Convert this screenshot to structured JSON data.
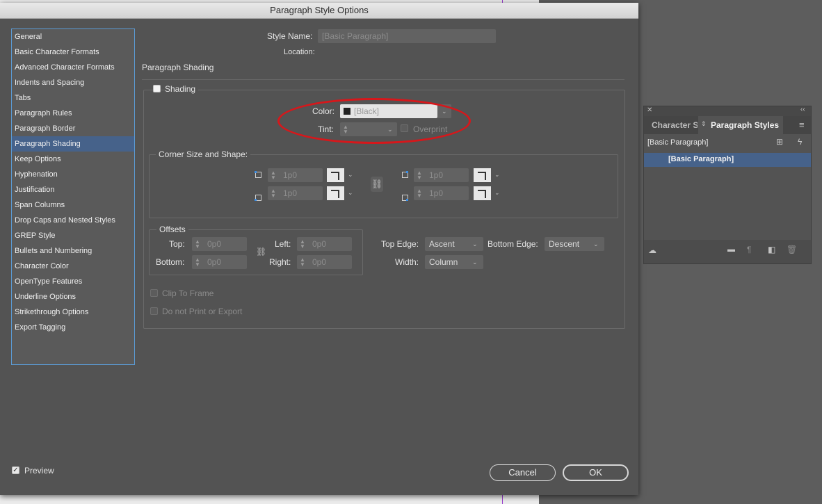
{
  "dialog": {
    "title": "Paragraph Style Options",
    "style_name_label": "Style Name:",
    "style_name_value": "[Basic Paragraph]",
    "location_label": "Location:",
    "section_title": "Paragraph Shading",
    "sidebar": [
      {
        "label": "General"
      },
      {
        "label": "Basic Character Formats"
      },
      {
        "label": "Advanced Character Formats"
      },
      {
        "label": "Indents and Spacing"
      },
      {
        "label": "Tabs"
      },
      {
        "label": "Paragraph Rules"
      },
      {
        "label": "Paragraph Border"
      },
      {
        "label": "Paragraph Shading",
        "selected": true
      },
      {
        "label": "Keep Options"
      },
      {
        "label": "Hyphenation"
      },
      {
        "label": "Justification"
      },
      {
        "label": "Span Columns"
      },
      {
        "label": "Drop Caps and Nested Styles"
      },
      {
        "label": "GREP Style"
      },
      {
        "label": "Bullets and Numbering"
      },
      {
        "label": "Character Color"
      },
      {
        "label": "OpenType Features"
      },
      {
        "label": "Underline Options"
      },
      {
        "label": "Strikethrough Options"
      },
      {
        "label": "Export Tagging"
      }
    ],
    "shading": {
      "checkbox_label": "Shading",
      "checked": false,
      "color_label": "Color:",
      "color_value": "[Black]",
      "tint_label": "Tint:",
      "tint_value": "",
      "overprint_label": "Overprint"
    },
    "corner": {
      "title": "Corner Size and Shape:",
      "values": [
        "1p0",
        "1p0",
        "1p0",
        "1p0"
      ]
    },
    "offsets": {
      "title": "Offsets",
      "top_label": "Top:",
      "top_value": "0p0",
      "bottom_label": "Bottom:",
      "bottom_value": "0p0",
      "left_label": "Left:",
      "left_value": "0p0",
      "right_label": "Right:",
      "right_value": "0p0"
    },
    "edges": {
      "top_edge_label": "Top Edge:",
      "top_edge_value": "Ascent",
      "bottom_edge_label": "Bottom Edge:",
      "bottom_edge_value": "Descent",
      "width_label": "Width:",
      "width_value": "Column"
    },
    "clip_label": "Clip To Frame",
    "noprint_label": "Do not Print or Export",
    "preview_label": "Preview",
    "preview_checked": true,
    "cancel_label": "Cancel",
    "ok_label": "OK"
  },
  "panel": {
    "tab_character": "Character S",
    "tab_paragraph": "Paragraph Styles",
    "current_style": "[Basic Paragraph]",
    "items": [
      "[Basic Paragraph]"
    ]
  },
  "colors": {
    "accent": "#5b9bd5",
    "selection": "#46628a",
    "annotation": "#d6171b"
  },
  "icons": {
    "swatch": "black-swatch-icon",
    "link": "link-icon",
    "new_style": "new-style-icon",
    "clear_overrides": "lightning-icon",
    "folder": "folder-icon",
    "trash": "trash-icon",
    "cloud": "cloud-library-icon",
    "menu": "panel-menu-icon"
  }
}
